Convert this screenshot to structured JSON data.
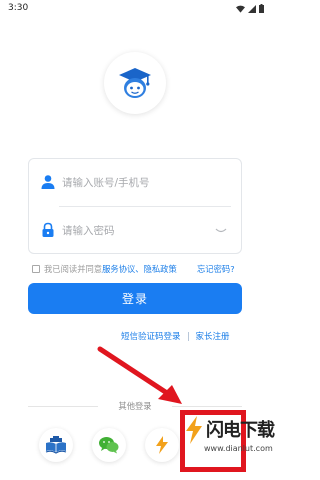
{
  "status_bar": {
    "time": "3:30"
  },
  "login": {
    "account_placeholder": "请输入账号/手机号",
    "password_placeholder": "请输入密码",
    "agree_prefix": "我已阅读并同意",
    "agree_links": "服务协议、隐私政策",
    "forgot_password": "忘记密码?",
    "login_button": "登录"
  },
  "links": {
    "sms_login": "短信验证码登录",
    "parent_register": "家长注册"
  },
  "other_login": {
    "label": "其他登录"
  },
  "watermark": {
    "title": "闪电下载",
    "url": "www.dianlut.com"
  },
  "colors": {
    "primary": "#1a7df2",
    "annotation_red": "#e0161f"
  }
}
